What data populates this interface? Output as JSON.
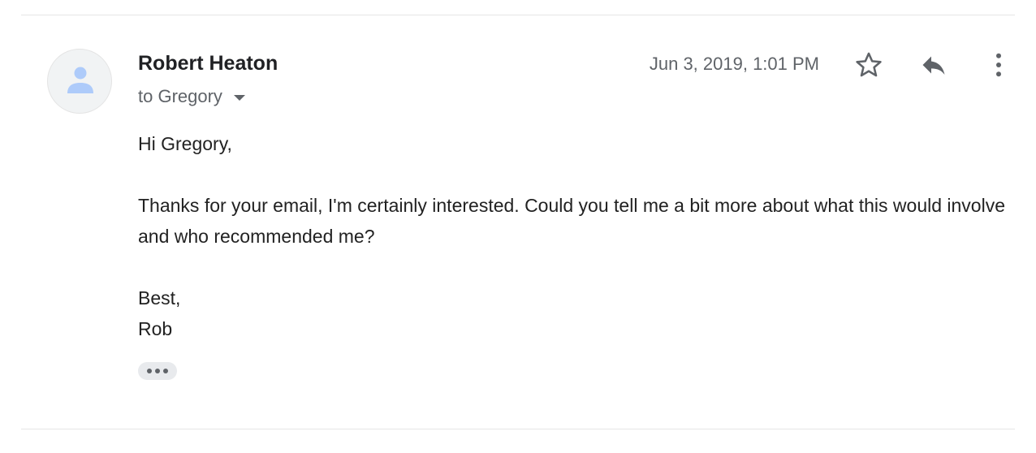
{
  "message": {
    "sender_name": "Robert Heaton",
    "recipient_label": "to Gregory",
    "timestamp": "Jun 3, 2019, 1:01 PM",
    "body": {
      "greeting": "Hi Gregory,",
      "paragraph": "Thanks for your email, I'm certainly interested. Could you tell me a bit more about what this would involve and who recommended me?",
      "signoff": "Best,",
      "signature": "Rob"
    }
  },
  "icons": {
    "avatar": "person-icon",
    "star": "star-icon",
    "reply": "reply-icon",
    "more": "more-vertical-icon",
    "recipient_dropdown": "caret-down-icon",
    "trimmed_content": "ellipsis-icon"
  },
  "colors": {
    "avatar_bg": "#f1f3f4",
    "avatar_figure": "#aecbfa",
    "icon_gray": "#5f6368",
    "text_primary": "#202124",
    "text_secondary": "#5f6368"
  }
}
